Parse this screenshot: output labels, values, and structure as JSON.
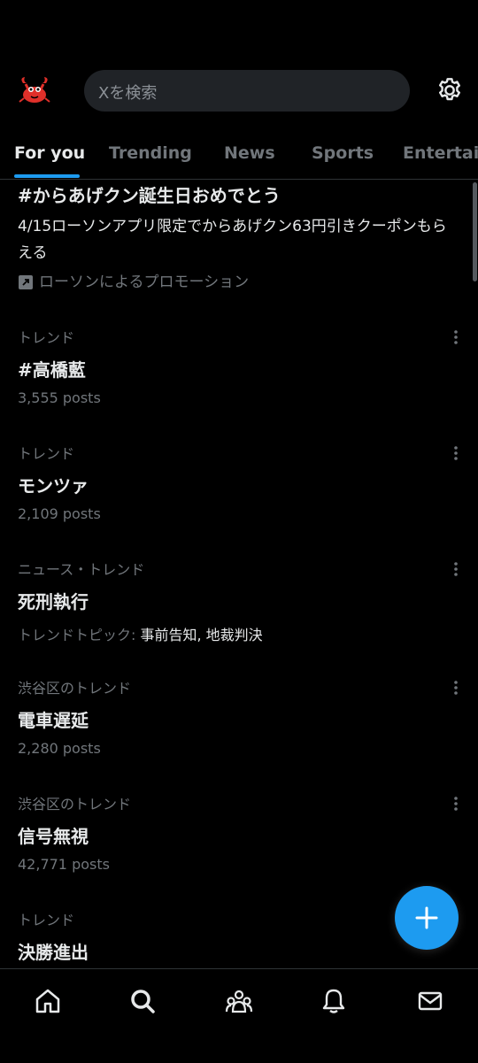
{
  "header": {
    "avatar_icon": "crab-avatar-icon",
    "search_placeholder": "Xを検索",
    "settings_icon": "gear-icon"
  },
  "tabs": [
    {
      "label": "For you",
      "active": true
    },
    {
      "label": "Trending",
      "active": false
    },
    {
      "label": "News",
      "active": false
    },
    {
      "label": "Sports",
      "active": false
    },
    {
      "label": "Entertain",
      "active": false
    }
  ],
  "promo": {
    "title": "#からあげクン誕生日おめでとう",
    "description": "4/15ローソンアプリ限定でからあげクン63円引きクーポンもらえる",
    "promoted_by": "ローソンによるプロモーション"
  },
  "trends": [
    {
      "meta": "トレンド",
      "title": "#高橋藍",
      "count": "3,555 posts"
    },
    {
      "meta": "トレンド",
      "title": "モンツァ",
      "count": "2,109 posts"
    },
    {
      "meta": "ニュース・トレンド",
      "title": "死刑執行",
      "topics_label": "トレンドトピック: ",
      "topics": "事前告知, 地裁判決"
    },
    {
      "meta": "渋谷区のトレンド",
      "title": "電車遅延",
      "count": "2,280 posts"
    },
    {
      "meta": "渋谷区のトレンド",
      "title": "信号無視",
      "count": "42,771 posts"
    },
    {
      "meta": "トレンド",
      "title": "決勝進出"
    }
  ],
  "colors": {
    "accent": "#1d9bf0",
    "background": "#000000",
    "secondary_text": "#71767b"
  },
  "bottom_nav": [
    "home-icon",
    "search-icon",
    "communities-icon",
    "notifications-icon",
    "messages-icon"
  ]
}
